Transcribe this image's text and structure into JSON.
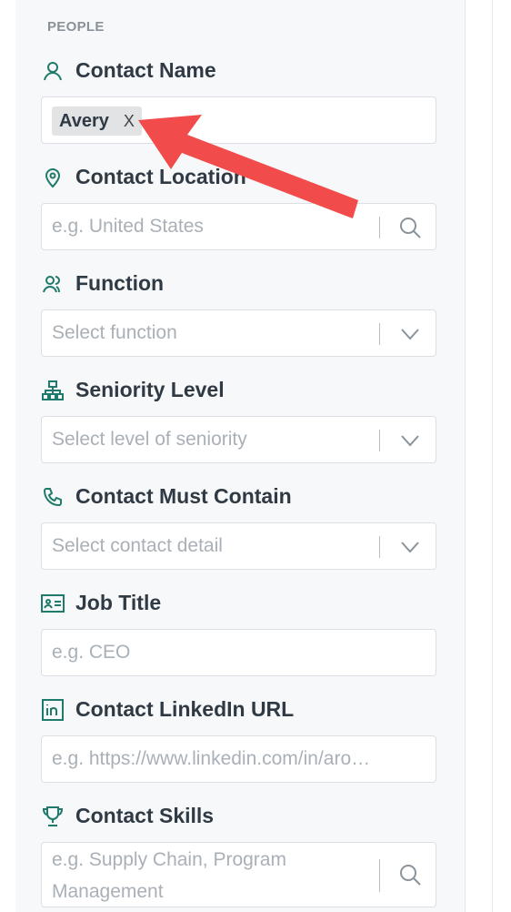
{
  "section": {
    "title": "PEOPLE"
  },
  "fields": {
    "contact_name": {
      "label": "Contact Name",
      "chip": "Avery",
      "chip_remove": "X"
    },
    "contact_location": {
      "label": "Contact Location",
      "placeholder": "e.g. United States",
      "trail_icon": "search-icon"
    },
    "function": {
      "label": "Function",
      "placeholder": "Select function",
      "trail_icon": "chevron-down-icon"
    },
    "seniority": {
      "label": "Seniority Level",
      "placeholder": "Select level of seniority",
      "trail_icon": "chevron-down-icon"
    },
    "must_contain": {
      "label": "Contact Must Contain",
      "placeholder": "Select contact detail",
      "trail_icon": "chevron-down-icon"
    },
    "job_title": {
      "label": "Job Title",
      "placeholder": "e.g. CEO"
    },
    "linkedin": {
      "label": "Contact LinkedIn URL",
      "placeholder": "e.g. https://www.linkedin.com/in/aro…"
    },
    "skills": {
      "label": "Contact Skills",
      "placeholder": "e.g. Supply Chain, Program Management",
      "trail_icon": "search-icon"
    }
  },
  "colors": {
    "icon_teal": "#1f7a6b",
    "annotation_arrow": "#f24b4b",
    "placeholder": "#a9b0b7",
    "text": "#2f3a44"
  }
}
